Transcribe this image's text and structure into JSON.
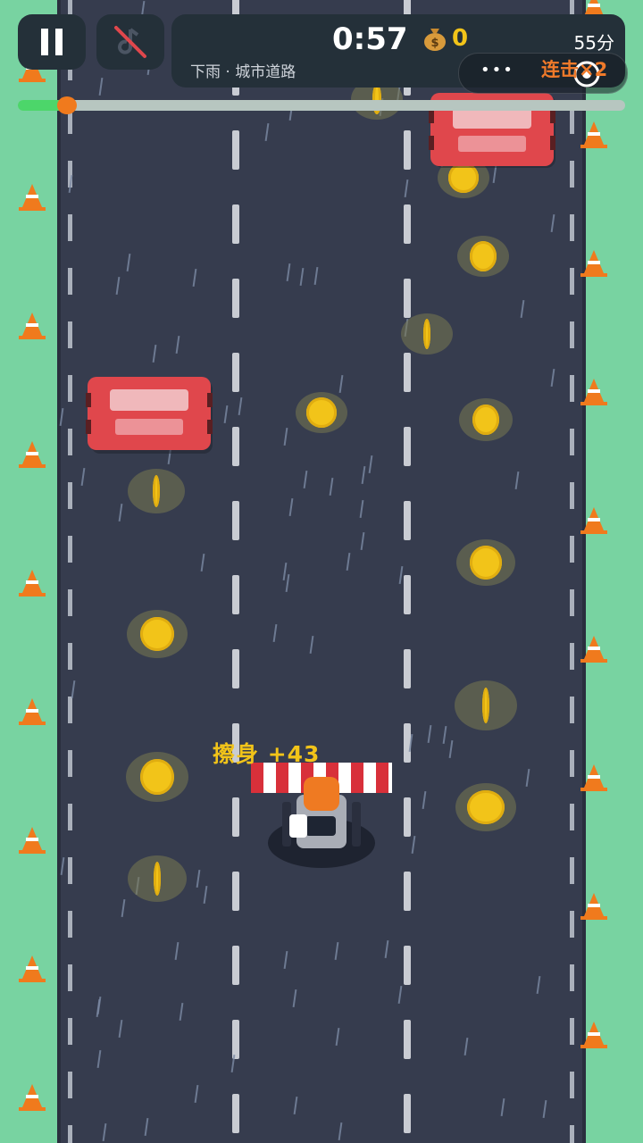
{
  "hud": {
    "pause_icon": "pause-icon",
    "music_icon": "music-muted-icon",
    "timer": "0:57",
    "coin_icon": "money-bag-icon",
    "coin_count": "0",
    "score": "55分",
    "weather_track": "下雨 · 城市道路",
    "combo": "连击×2",
    "menu_dots": "•••",
    "target_icon": "target-icon",
    "progress_fraction": 0.08
  },
  "popup_text": "擦身 +43",
  "colors": {
    "grass": "#78d3a1",
    "road": "#363c4e",
    "coin": "#f2c419",
    "enemy_car": "#e0474c",
    "cone": "#f07a1d",
    "progress": "#4cd66a"
  }
}
